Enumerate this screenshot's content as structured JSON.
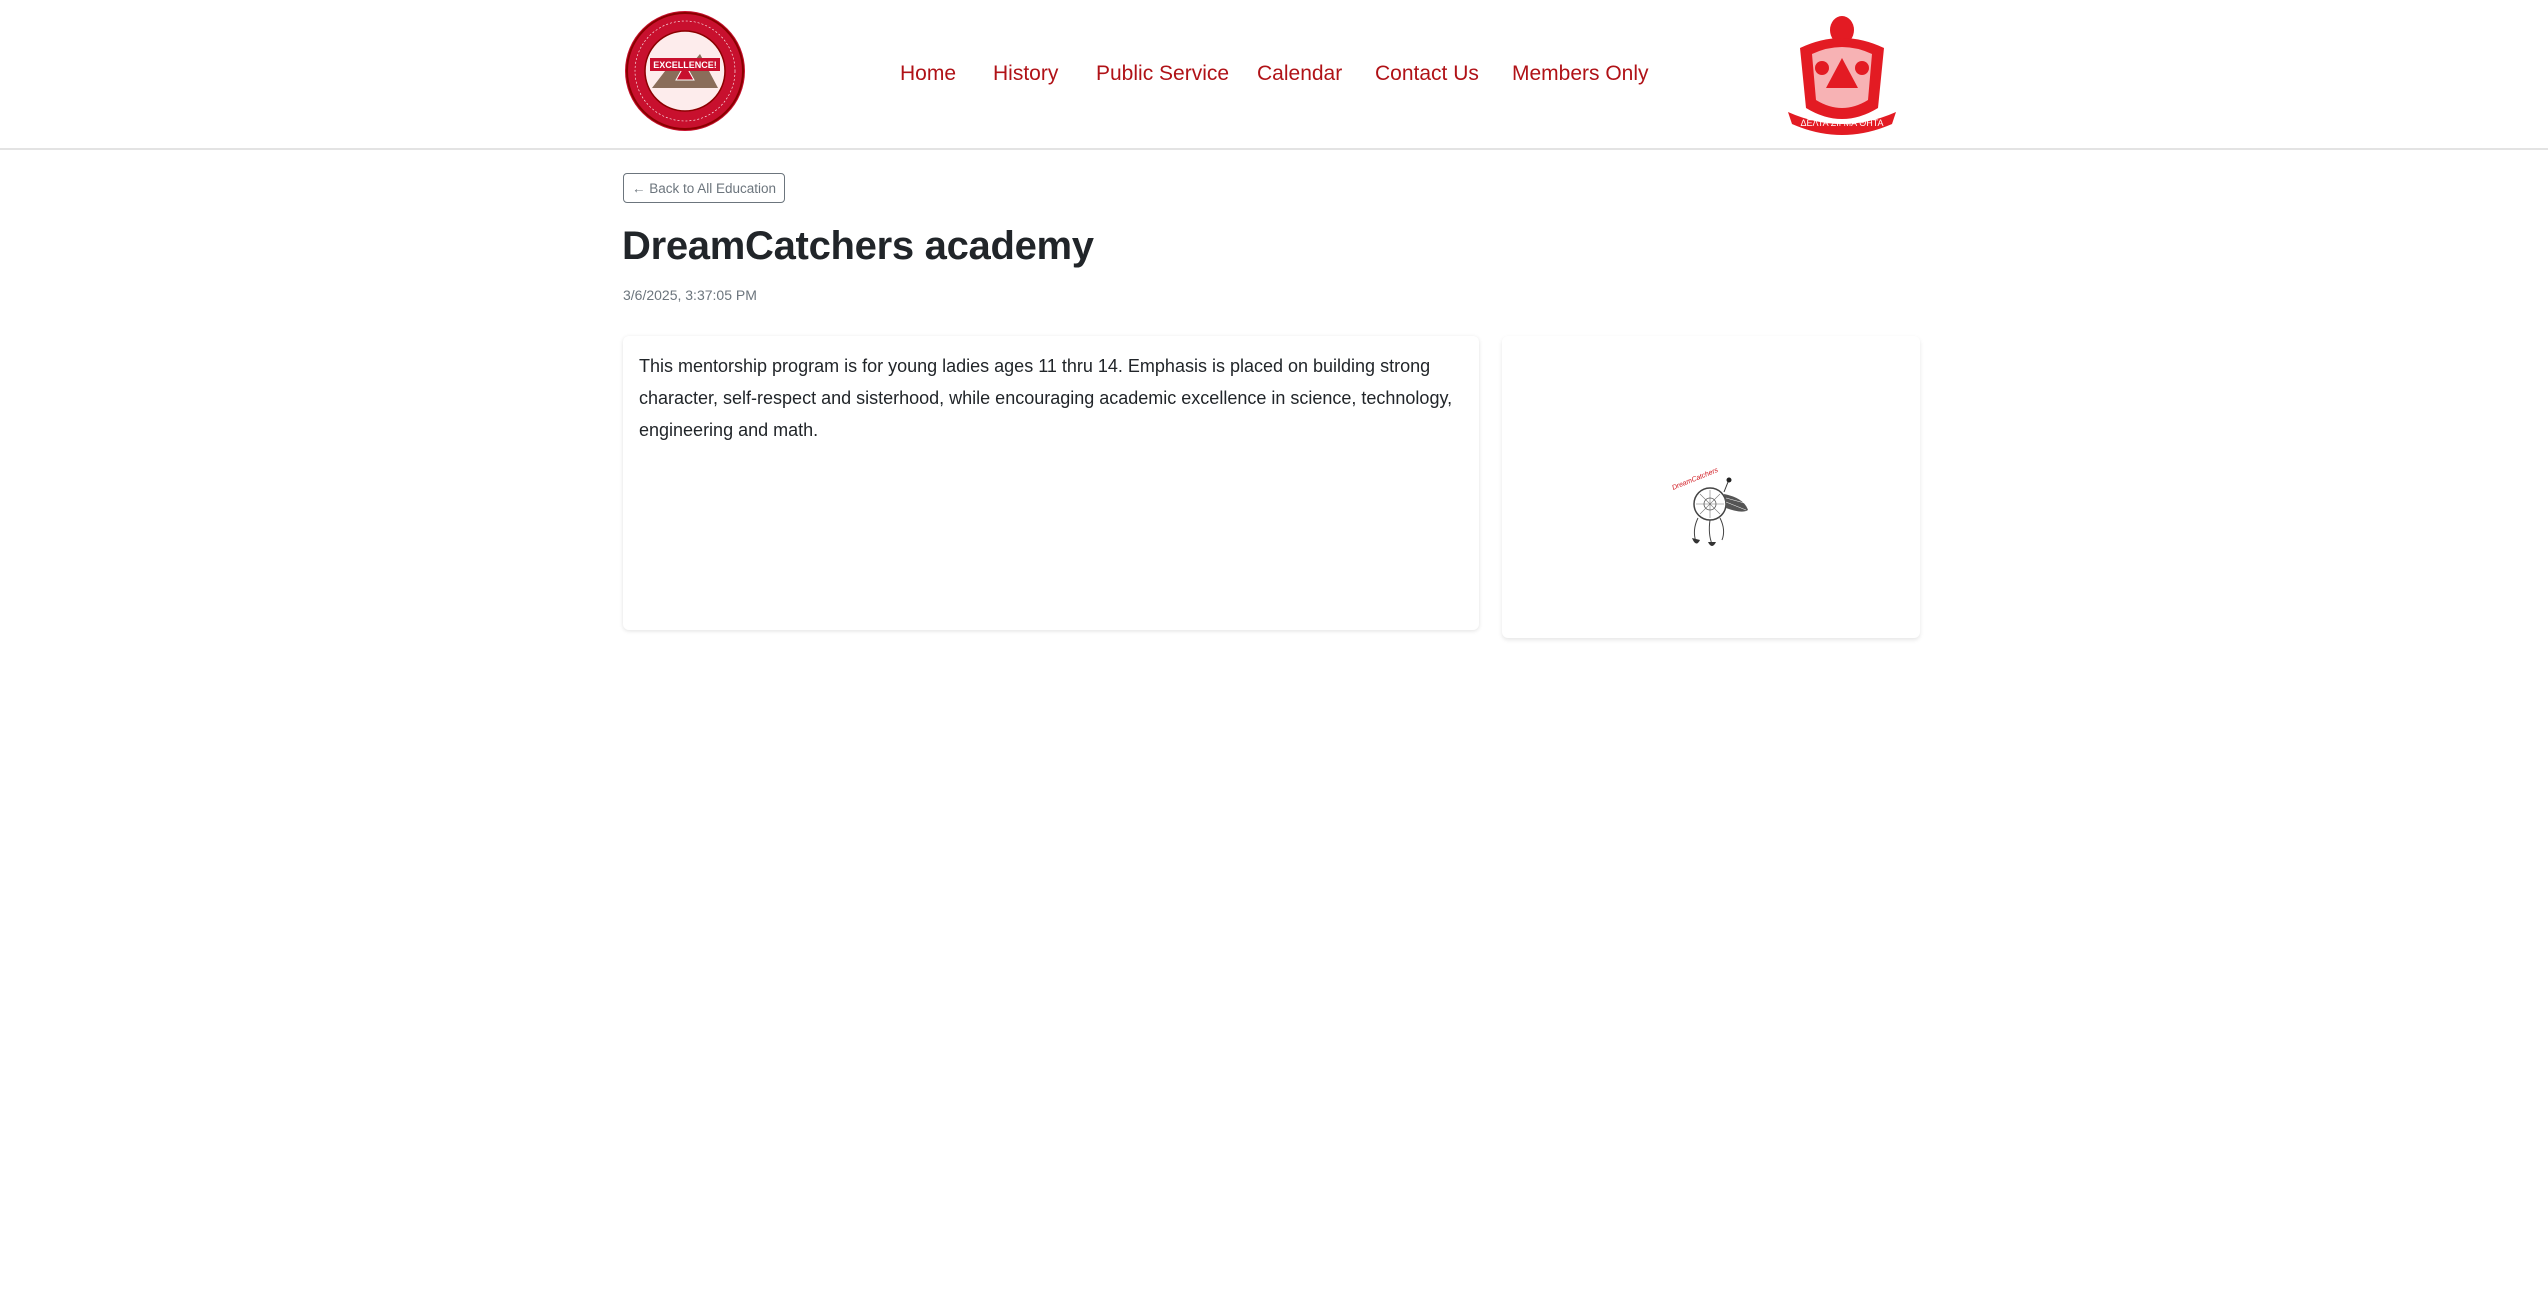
{
  "header": {
    "left_logo": {
      "icon": "chapter-seal-logo",
      "ring_text_top": "Lawton Alumnae Chapter",
      "center_text": "EXCELLENCE!",
      "ring_text_bottom": "Delta Sigma Theta Sorority, Inc.",
      "primary_color": "#c8102e"
    },
    "right_logo": {
      "icon": "delta-sigma-theta-crest",
      "banner_text": "ΔΕΛΤΑ ΣΙΓΜΑ ΘΗΤΑ",
      "primary_color": "#e31b23"
    },
    "nav": [
      {
        "label": "Home"
      },
      {
        "label": "History"
      },
      {
        "label": "Public Service"
      },
      {
        "label": "Calendar"
      },
      {
        "label": "Contact Us"
      },
      {
        "label": "Members Only"
      }
    ],
    "nav_color": "#b01217"
  },
  "back_button": {
    "label": "← Back to All Education"
  },
  "article": {
    "title": "DreamCatchers academy",
    "timestamp": "3/6/2025, 3:37:05 PM",
    "body": "This mentorship program is for young ladies ages 11 thru 14. Emphasis is placed on building strong character, self-respect and sisterhood, while encouraging academic excellence in science, technology, engineering and math."
  },
  "image": {
    "icon": "dreamcatcher-illustration",
    "caption_text": "DreamCatchers"
  }
}
